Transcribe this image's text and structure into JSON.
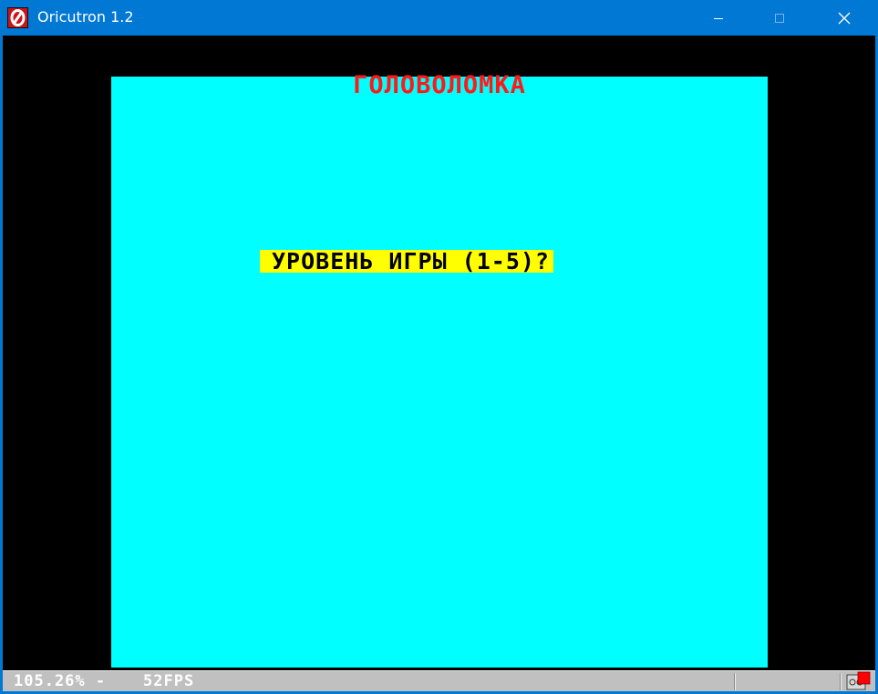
{
  "window": {
    "title": "Oricutron 1.2",
    "app_icon": "oricutron-logo-icon",
    "controls": [
      "minimize-icon",
      "maximize-icon",
      "close-icon"
    ]
  },
  "screen": {
    "heading": "ГОЛОВОЛОМКА",
    "prompt": "УРОВЕНЬ ИГРЫ (1-5)?",
    "colors": {
      "border": "#000000",
      "paper": "#00ffff",
      "heading": "#ff1a1a",
      "prompt_background": "#ffff00",
      "prompt_text": "#000000"
    }
  },
  "statusbar": {
    "speed": "105.26% -",
    "fps": "52FPS",
    "icons": [
      "tape-status-icon"
    ],
    "indicator_color": "#ff0000"
  }
}
